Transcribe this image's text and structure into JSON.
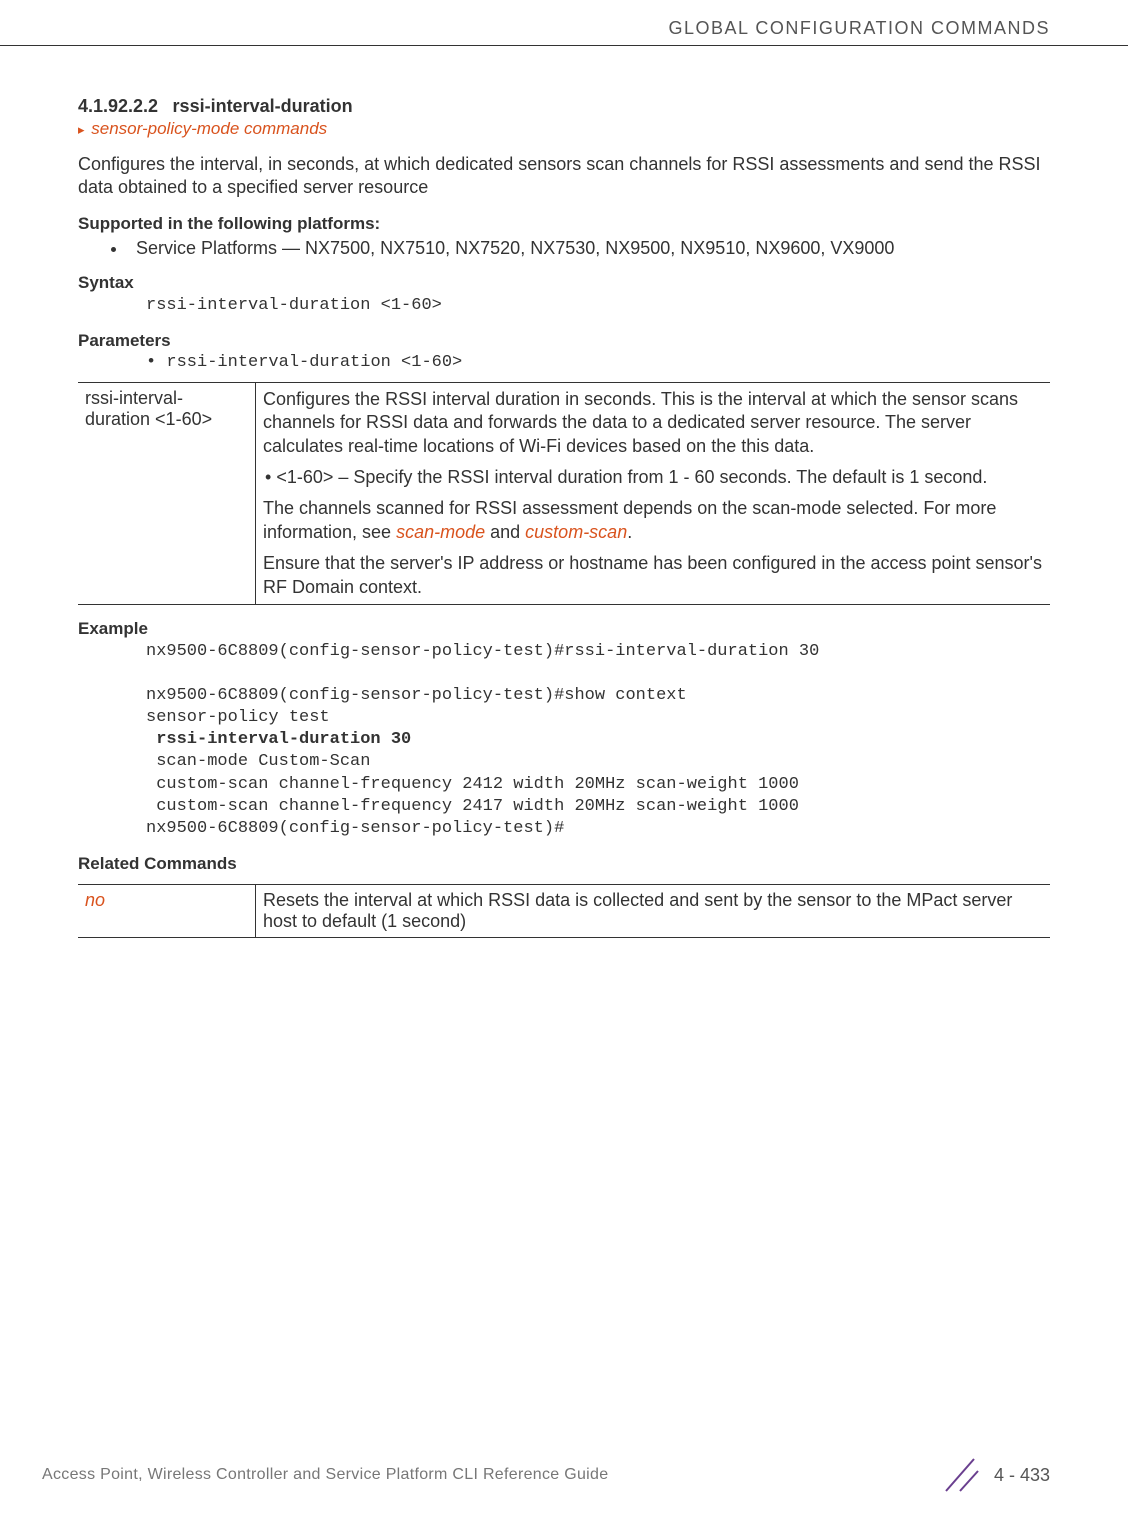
{
  "header": "GLOBAL CONFIGURATION COMMANDS",
  "section_number": "4.1.92.2.2",
  "section_title": "rssi-interval-duration",
  "breadcrumb": "sensor-policy-mode commands",
  "intro": "Configures the interval, in seconds, at which dedicated sensors scan channels for RSSI assessments and send the RSSI data obtained to a specified server resource",
  "supported_heading": "Supported in the following platforms:",
  "supported_item": "Service Platforms — NX7500, NX7510, NX7520, NX7530, NX9500, NX9510, NX9600, VX9000",
  "syntax_heading": "Syntax",
  "syntax_code": "rssi-interval-duration <1-60>",
  "parameters_heading": "Parameters",
  "parameters_bullet": "rssi-interval-duration <1-60>",
  "param_table": {
    "left": "rssi-interval-duration <1-60>",
    "p1": "Configures the RSSI interval duration in seconds. This is the interval at which the sensor scans channels for RSSI data and forwards the data to a dedicated server resource. The server calculates real-time locations of Wi-Fi devices based on the this data.",
    "p2": "<1-60> – Specify the RSSI interval duration from 1 - 60 seconds. The default is 1 second.",
    "p3_a": "The channels scanned for RSSI assessment depends on the scan-mode selected. For more information, see ",
    "p3_link1": "scan-mode",
    "p3_b": " and ",
    "p3_link2": "custom-scan",
    "p3_c": ".",
    "p4": "Ensure that the server's IP address or hostname has been configured in the access point sensor's RF Domain context."
  },
  "example_heading": "Example",
  "example_lines": {
    "l1": "nx9500-6C8809(config-sensor-policy-test)#rssi-interval-duration 30",
    "l2": "nx9500-6C8809(config-sensor-policy-test)#show context",
    "l3": "sensor-policy test",
    "l4": " rssi-interval-duration 30",
    "l5": " scan-mode Custom-Scan",
    "l6": " custom-scan channel-frequency 2412 width 20MHz scan-weight 1000",
    "l7": " custom-scan channel-frequency 2417 width 20MHz scan-weight 1000",
    "l8": "nx9500-6C8809(config-sensor-policy-test)#"
  },
  "related_heading": "Related Commands",
  "related_table": {
    "left": "no",
    "right": "Resets the interval at which RSSI data is collected and sent by the sensor to the MPact server host to default (1 second)"
  },
  "footer_left": "Access Point, Wireless Controller and Service Platform CLI Reference Guide",
  "footer_page": "4 - 433"
}
